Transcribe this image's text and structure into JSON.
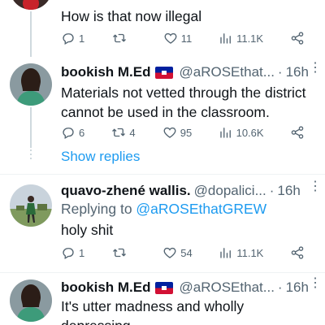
{
  "colors": {
    "accent": "#1d9bf0",
    "secondary": "#536471",
    "text": "#0f1419"
  },
  "tweets": [
    {
      "text": "How is that now illegal",
      "replies": "1",
      "retweets": "",
      "likes": "11",
      "views": "11.1K"
    },
    {
      "name": "bookish M.Ed",
      "handle": "@aROSEthat...",
      "dot": "·",
      "time": "16h",
      "text": "Materials not vetted through the district cannot be used in the classroom.",
      "replies": "6",
      "retweets": "4",
      "likes": "95",
      "views": "10.6K",
      "show_replies": "Show replies"
    },
    {
      "name": "quavo-zhené wallis.",
      "handle": "@dopalici...",
      "dot": "·",
      "time": "16h",
      "replying_prefix": "Replying to ",
      "replying_to": "@aROSEthatGREW",
      "text": "holy shit",
      "replies": "1",
      "retweets": "",
      "likes": "54",
      "views": "11.1K"
    },
    {
      "name": "bookish M.Ed",
      "handle": "@aROSEthat...",
      "dot": "·",
      "time": "16h",
      "text": "It's utter madness and wholly depressing"
    }
  ],
  "icons": [
    "reply-icon",
    "retweet-icon",
    "like-icon",
    "views-icon",
    "share-icon",
    "more-icon",
    "haiti-flag-icon"
  ]
}
